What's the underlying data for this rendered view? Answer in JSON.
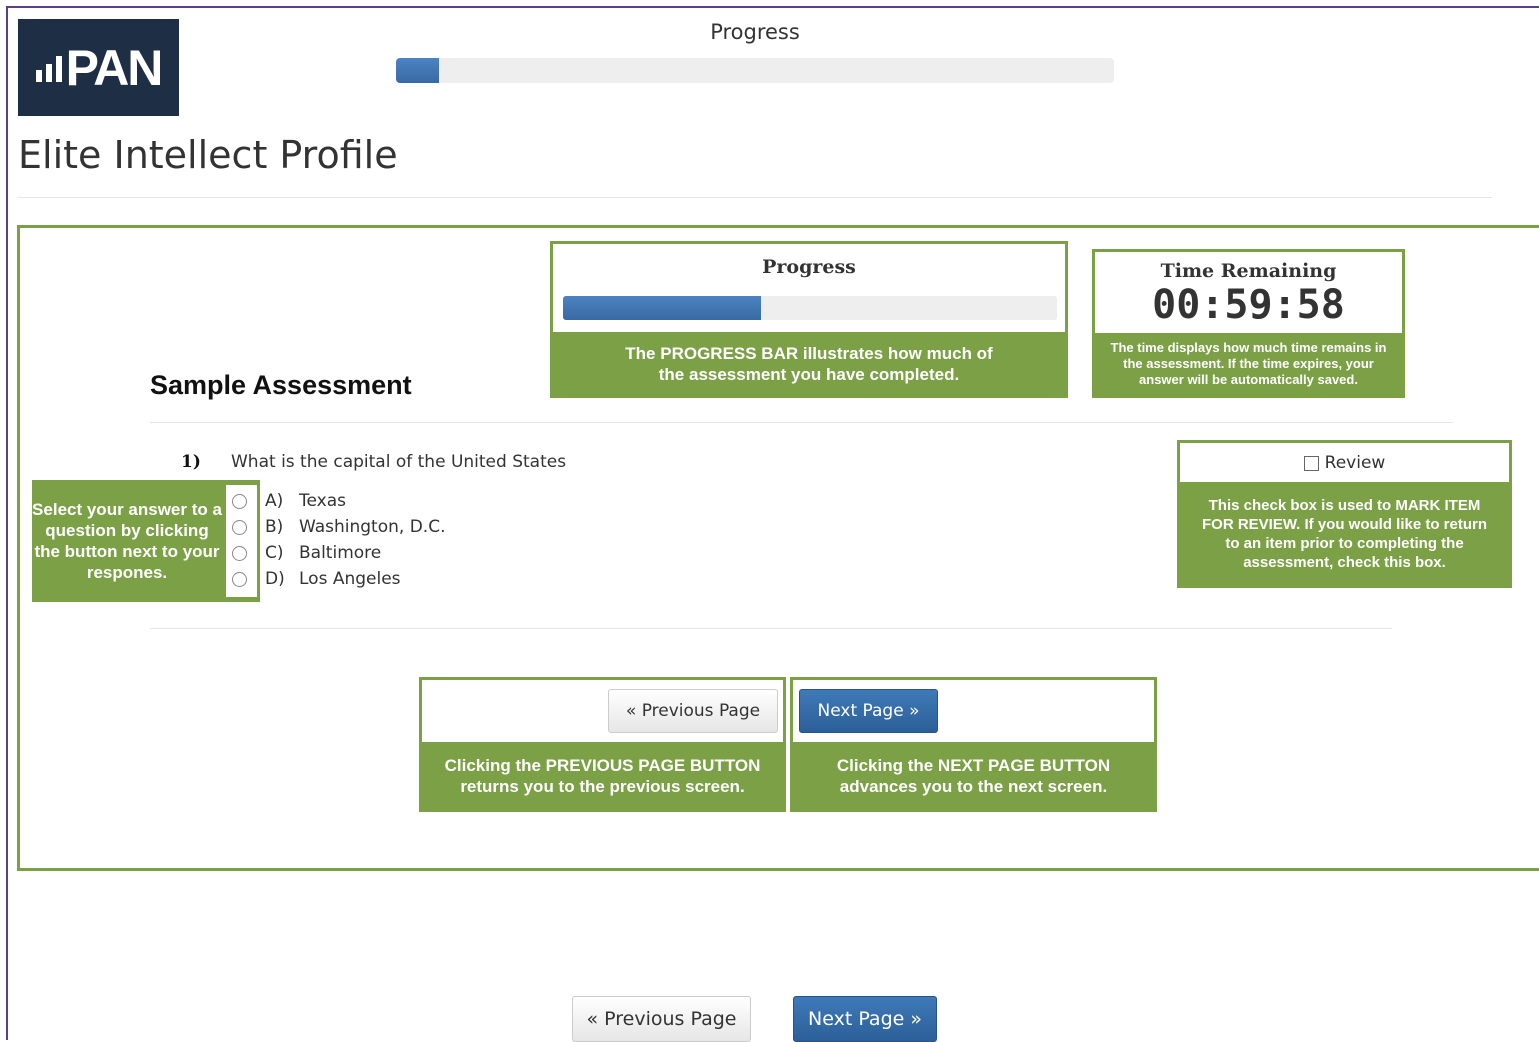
{
  "logo": {
    "text": "PAN"
  },
  "header": {
    "progress_label": "Progress",
    "progress_fraction": 0.06
  },
  "page_title": "Elite Intellect Profile",
  "guide": {
    "progress_callout": {
      "title": "Progress",
      "progress_fraction": 0.4,
      "description": "The PROGRESS BAR illustrates how much of the assessment you have completed."
    },
    "time_callout": {
      "title": "Time Remaining",
      "time": "00:59:58",
      "description": "The time displays how much time remains in the assessment. If the time expires, your answer will be automatically saved."
    },
    "sample_title": "Sample Assessment",
    "question": {
      "number": "1)",
      "text": "What is the capital of the United States",
      "options": [
        {
          "letter": "A)",
          "label": "Texas"
        },
        {
          "letter": "B)",
          "label": "Washington, D.C."
        },
        {
          "letter": "C)",
          "label": "Baltimore"
        },
        {
          "letter": "D)",
          "label": "Los Angeles"
        }
      ]
    },
    "answer_callout": "Select your answer to a question by clicking the button next to your respones.",
    "review_callout": {
      "checkbox_label": "Review",
      "description": "This check box is used to MARK ITEM FOR REVIEW. If you would like to return to an item prior to completing the assessment, check this box."
    },
    "prev_callout": {
      "button_label": "« Previous Page",
      "description": "Clicking the PREVIOUS PAGE BUTTON returns you to the previous screen."
    },
    "next_callout": {
      "button_label": "Next Page »",
      "description": "Clicking the NEXT PAGE BUTTON advances you to the next screen."
    }
  },
  "footer": {
    "prev_label": "« Previous Page",
    "next_label": "Next Page »"
  },
  "colors": {
    "callout_green": "#7ba046",
    "primary_blue": "#2c5f98",
    "logo_bg": "#1e2f45",
    "frame_purple": "#5b3e8a"
  }
}
